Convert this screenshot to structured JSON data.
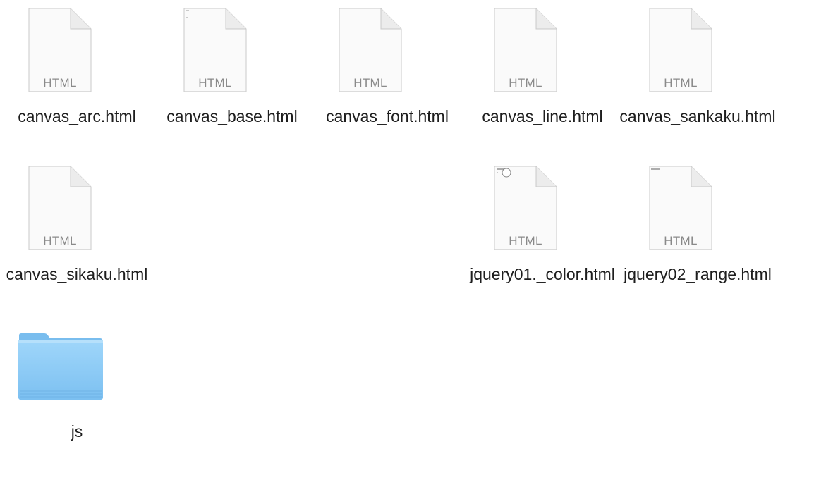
{
  "files": [
    {
      "name": "canvas_arc.html",
      "type": "HTML",
      "thumb": "blank-document-icon"
    },
    {
      "name": "canvas_base.html",
      "type": "HTML",
      "thumb": "tiny-preview-document-icon"
    },
    {
      "name": "canvas_font.html",
      "type": "HTML",
      "thumb": "blank-document-icon"
    },
    {
      "name": "canvas_line.html",
      "type": "HTML",
      "thumb": "blank-document-icon"
    },
    {
      "name": "canvas_sankaku.html",
      "type": "HTML",
      "thumb": "blank-document-icon"
    },
    {
      "name": "canvas_sikaku.html",
      "type": "HTML",
      "thumb": "blank-document-icon"
    },
    {
      "name": "jquery01._color.html",
      "type": "HTML",
      "thumb": "circle-preview-document-icon"
    },
    {
      "name": "jquery02_range.html",
      "type": "HTML",
      "thumb": "text-preview-document-icon"
    }
  ],
  "folders": [
    {
      "name": "js",
      "icon": "folder-icon"
    }
  ],
  "colors": {
    "folder": "#8ccaf5",
    "label": "#1e1e1e",
    "type_text": "#8a8a8a"
  }
}
